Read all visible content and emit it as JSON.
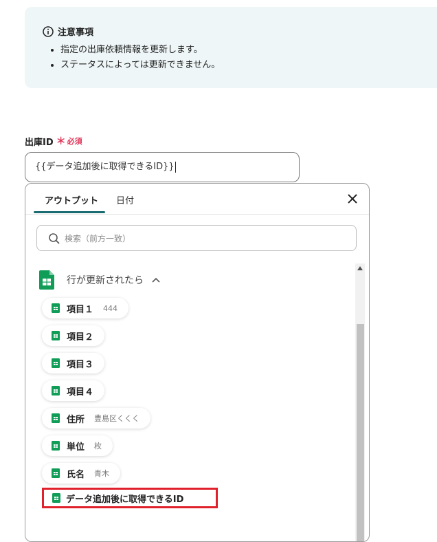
{
  "notice": {
    "title": "注意事項",
    "items": [
      "指定の出庫依頼情報を更新します。",
      "ステータスによっては更新できません。"
    ]
  },
  "field": {
    "label": "出庫ID",
    "required_mark": "＊",
    "required_text": "必須",
    "value": "{{データ追加後に取得できるID}}"
  },
  "panel": {
    "tabs": [
      {
        "label": "アウトプット",
        "active": true
      },
      {
        "label": "日付",
        "active": false
      }
    ],
    "search_placeholder": "検索（前方一致）",
    "group": {
      "title": "行が更新されたら",
      "items": [
        {
          "label": "項目１",
          "value": "444"
        },
        {
          "label": "項目２",
          "value": ""
        },
        {
          "label": "項目３",
          "value": ""
        },
        {
          "label": "項目４",
          "value": ""
        },
        {
          "label": "住所",
          "value": "豊島区くくく"
        },
        {
          "label": "単位",
          "value": "枚"
        },
        {
          "label": "氏名",
          "value": "青木"
        },
        {
          "label": "データ追加後に取得できるID",
          "value": ""
        }
      ]
    }
  },
  "colors": {
    "accent": "#1b6b73",
    "required": "#e0365a",
    "highlight": "#e0202a",
    "sheets_green": "#0f9d58",
    "notice_bg": "#eef6f7"
  },
  "icons": [
    "info-icon",
    "close-icon",
    "search-icon",
    "google-sheets-icon",
    "chevron-up-icon"
  ]
}
